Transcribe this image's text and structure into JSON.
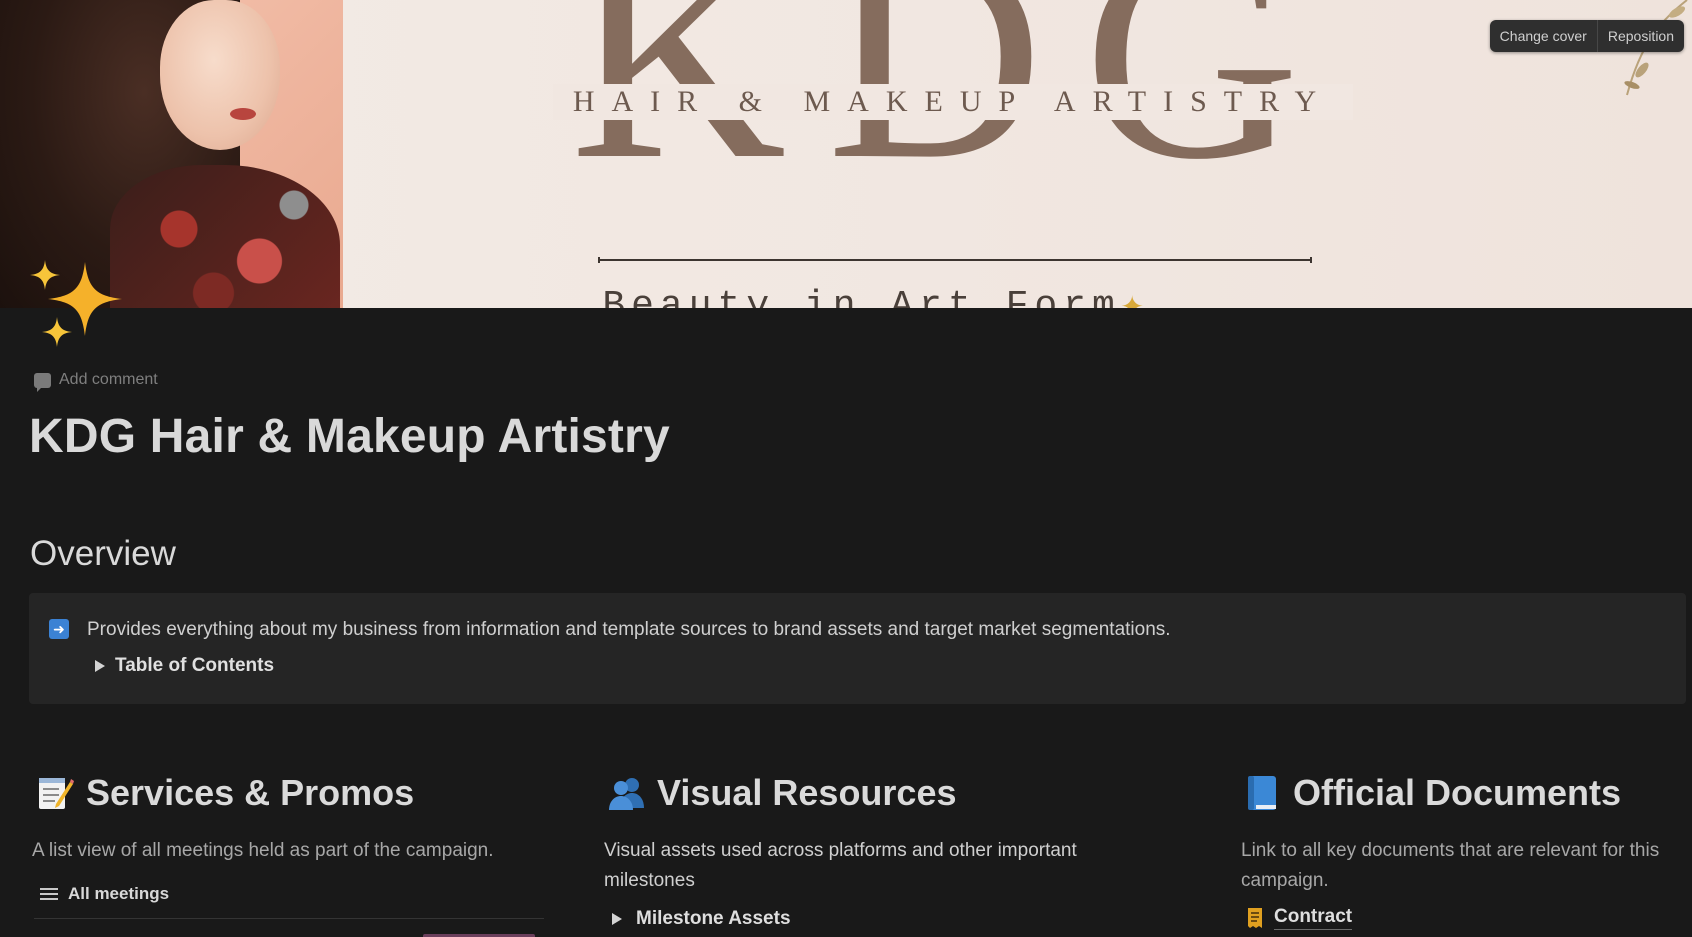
{
  "cover": {
    "logo_text": "KDG",
    "subtitle": "HAIR & MAKEUP ARTISTRY",
    "tagline": "Beauty in Art Form",
    "buttons": {
      "change_cover": "Change cover",
      "reposition": "Reposition"
    }
  },
  "page": {
    "icon": "sparkles-icon",
    "add_comment": "Add comment",
    "title": "KDG Hair & Makeup Artistry"
  },
  "overview": {
    "heading": "Overview",
    "callout_icon": "right-arrow-icon",
    "callout_text": "Provides everything about my business from information and template sources to brand assets and target market segmentations.",
    "toggle_label": "Table of Contents"
  },
  "columns": {
    "services": {
      "icon": "memo-icon",
      "heading": "Services & Promos",
      "description": "A list view of all meetings held as part of the campaign.",
      "view_label": "All meetings"
    },
    "visual": {
      "icon": "people-icon",
      "heading": "Visual Resources",
      "description": "Visual assets used across platforms and other important milestones",
      "toggle_label": "Milestone Assets"
    },
    "documents": {
      "icon": "book-icon",
      "heading": "Official Documents",
      "description": "Link to all key documents that are relevant for this campaign.",
      "link_label": "Contract",
      "link_icon": "receipt-icon"
    }
  },
  "colors": {
    "background": "#191919",
    "callout_bg": "#252525",
    "accent_blue": "#3b82d4",
    "sparkle_gold": "#f5b12a",
    "logo_brown": "#856c5d"
  }
}
